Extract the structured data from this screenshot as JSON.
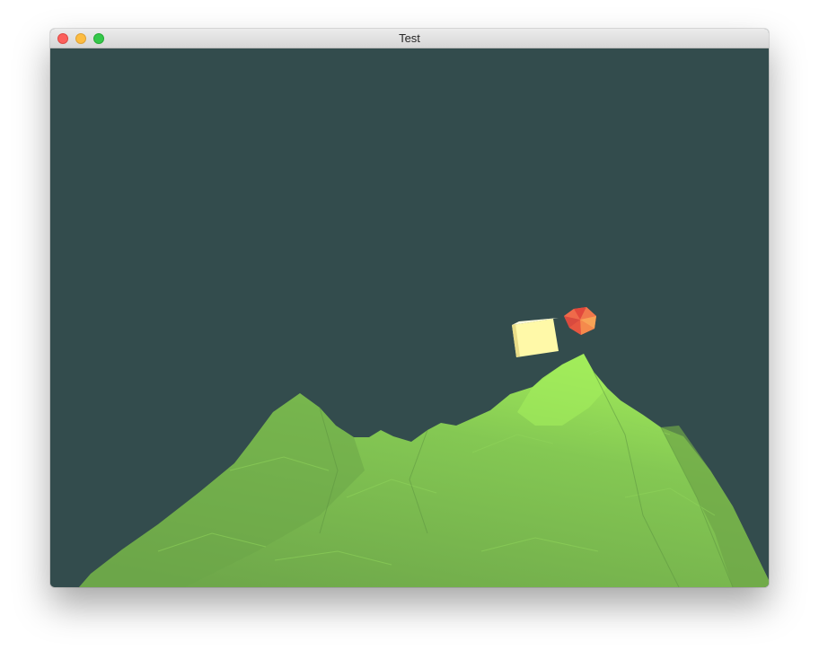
{
  "window": {
    "title": "Test",
    "buttons": {
      "close": "close",
      "minimize": "minimize",
      "zoom": "zoom"
    }
  },
  "scene": {
    "background_color": "#334c4d",
    "terrain_color": "#7ab84f",
    "terrain_highlight_color": "#9be556",
    "cube_color": "#fff9a8",
    "icosahedron_color": "#f4604e"
  }
}
